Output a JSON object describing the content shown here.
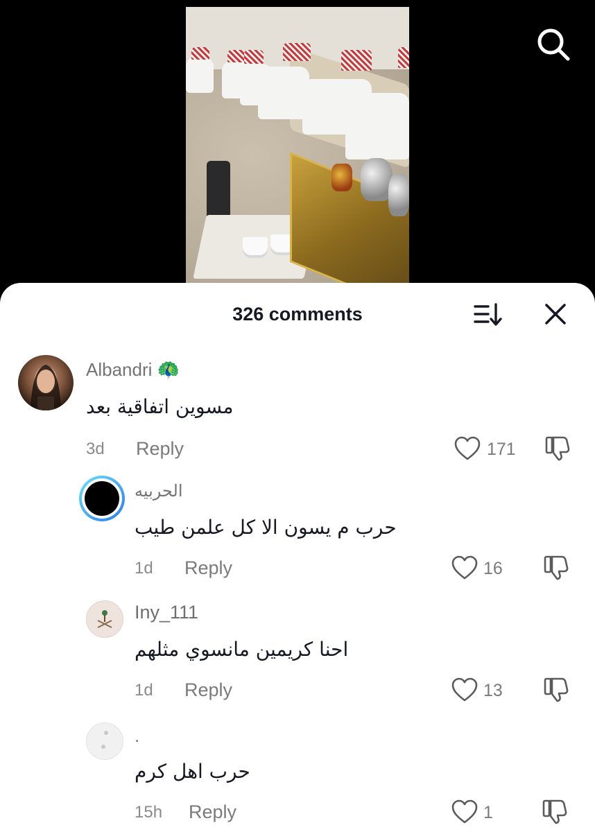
{
  "header": {
    "comment_count": "326 comments"
  },
  "icons": {
    "search": "search-icon",
    "sort": "sort-icon",
    "close": "close-icon",
    "like": "heart-icon",
    "dislike": "thumbs-down-icon"
  },
  "colors": {
    "sheet_background": "#ffffff",
    "secondary_text": "#7a7a7a",
    "primary_text": "#161823",
    "story_ring_start": "#4fd1f5",
    "story_ring_end": "#2a7bf0"
  },
  "comments": [
    {
      "username": "Albandri 🦚",
      "text": "مسوين اتفاقية بعد",
      "time": "3d",
      "reply_label": "Reply",
      "likes": "171"
    },
    {
      "username": "الحربيه",
      "text": "حرب م يسون الا كل علمن طيب",
      "time": "1d",
      "reply_label": "Reply",
      "likes": "16"
    },
    {
      "username": "Iny_111",
      "text": "احنا كريمين مانسوي مثلهم",
      "time": "1d",
      "reply_label": "Reply",
      "likes": "13"
    },
    {
      "username": ".",
      "text": "حرب اهل كرم",
      "time": "15h",
      "reply_label": "Reply",
      "likes": "1"
    }
  ]
}
